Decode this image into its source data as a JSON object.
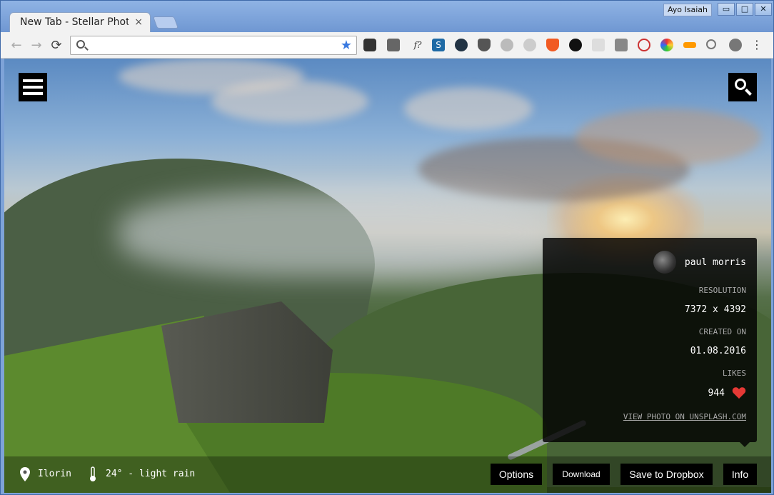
{
  "browser": {
    "tab_title": "New Tab - Stellar Photo",
    "tab_close": "×",
    "profile_name": "Ayo Isaiah",
    "window_controls": {
      "minimize": "▭",
      "maximize": "□",
      "close": "✕"
    },
    "nav": {
      "back": "←",
      "forward": "→",
      "reload": "⟳"
    },
    "omnibox": {
      "value": "",
      "star": "★"
    },
    "extensions": [
      "pocket-icon",
      "eyedropper-icon",
      "f-question-icon",
      "s-icon",
      "lock-circle-icon",
      "ublock-icon",
      "atom-icon",
      "eye-icon",
      "brave-icon",
      "gnome-icon",
      "file-icon",
      "camera-icon",
      "anarchy-icon",
      "color-wheel-icon",
      "tag-icon",
      "magnifier-icon",
      "bug-icon",
      "more-icon"
    ],
    "extension_glyphs": {
      "f_question": "f?",
      "s": "S",
      "more": "⋮"
    }
  },
  "page": {
    "info": {
      "author": "paul morris",
      "resolution_label": "RESOLUTION",
      "resolution": "7372 x 4392",
      "created_label": "CREATED ON",
      "created": "01.08.2016",
      "likes_label": "LIKES",
      "likes": "944",
      "unsplash_link": "VIEW PHOTO ON UNSPLASH.COM"
    },
    "location": "Ilorin",
    "weather": "24° - light rain",
    "buttons": {
      "options": "Options",
      "download": "Download",
      "save_dropbox": "Save to Dropbox",
      "info": "Info"
    }
  },
  "colors": {
    "accent_heart": "#e53935",
    "tab_bg": "#f2f2f2",
    "window_frame": "#7ea3d8"
  }
}
